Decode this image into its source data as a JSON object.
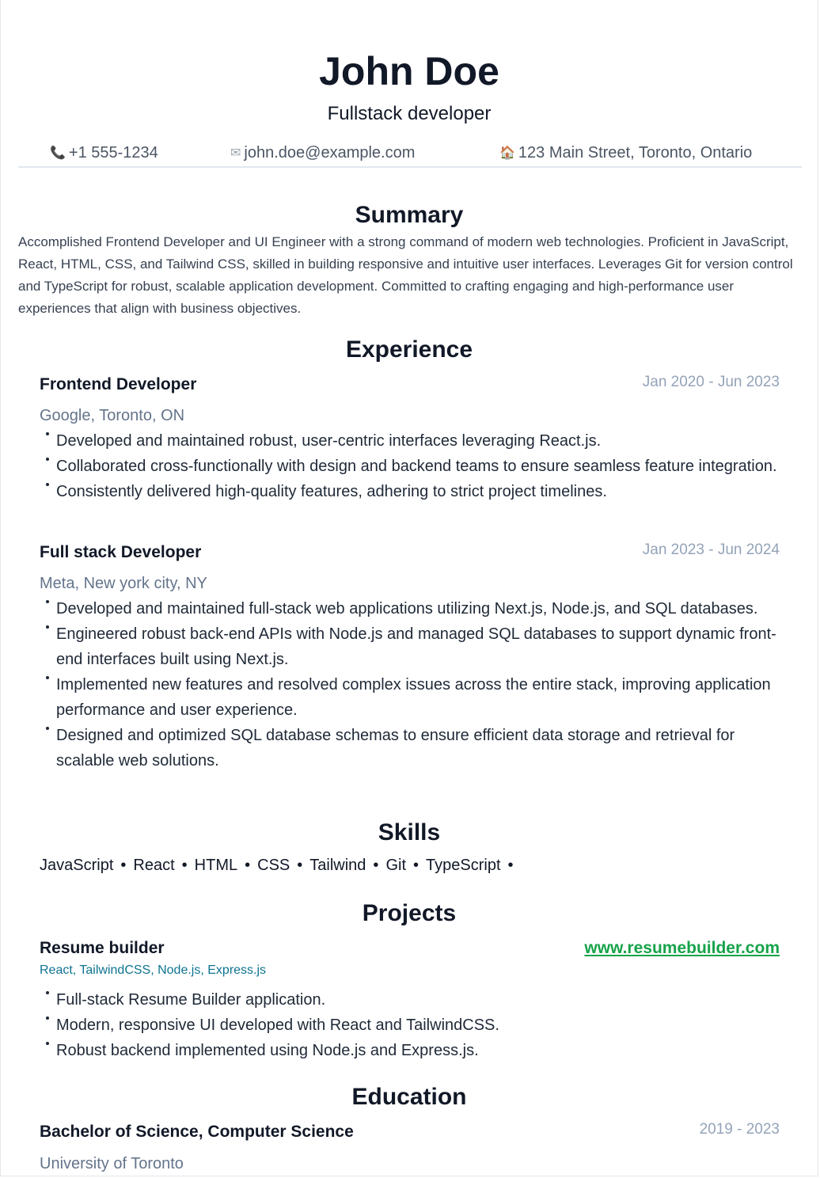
{
  "header": {
    "name": "John Doe",
    "role": "Fullstack developer",
    "phone": "+1 555-1234",
    "email": "john.doe@example.com",
    "address": "123 Main Street, Toronto, Ontario",
    "phone_icon": "📞",
    "email_icon": "✉",
    "address_icon": "🏠"
  },
  "summary": {
    "title": "Summary",
    "text": "Accomplished Frontend Developer and UI Engineer with a strong command of modern web technologies. Proficient in JavaScript, React, HTML, CSS, and Tailwind CSS, skilled in building responsive and intuitive user interfaces. Leverages Git for version control and TypeScript for robust, scalable application development. Committed to crafting engaging and high-performance user experiences that align with business objectives."
  },
  "experience": {
    "title": "Experience",
    "jobs": [
      {
        "title": "Frontend Developer",
        "dates": "Jan 2020 - Jun 2023",
        "org": "Google, Toronto, ON",
        "bullets": [
          "Developed and maintained robust, user-centric interfaces leveraging React.js.",
          "Collaborated cross-functionally with design and backend teams to ensure seamless feature integration.",
          "Consistently delivered high-quality features, adhering to strict project timelines."
        ]
      },
      {
        "title": "Full stack Developer",
        "dates": "Jan 2023 - Jun 2024",
        "org": "Meta, New york city, NY",
        "bullets": [
          "Developed and maintained full-stack web applications utilizing Next.js, Node.js, and SQL databases.",
          "Engineered robust back-end APIs with Node.js and managed SQL databases to support dynamic front-end interfaces built using Next.js.",
          "Implemented new features and resolved complex issues across the entire stack, improving application performance and user experience.",
          "Designed and optimized SQL database schemas to ensure efficient data storage and retrieval for scalable web solutions."
        ]
      }
    ]
  },
  "skills": {
    "title": "Skills",
    "separator": "•",
    "items": [
      "JavaScript",
      "React",
      "HTML",
      "CSS",
      "Tailwind",
      "Git",
      "TypeScript"
    ]
  },
  "projects": {
    "title": "Projects",
    "items": [
      {
        "title": "Resume builder",
        "link": "www.resumebuilder.com",
        "tech": "React, TailwindCSS, Node.js, Express.js",
        "bullets": [
          "Full-stack Resume Builder application.",
          "Modern, responsive UI developed with React and TailwindCSS.",
          "Robust backend implemented using Node.js and Express.js."
        ]
      }
    ]
  },
  "education": {
    "title": "Education",
    "items": [
      {
        "degree": "Bachelor of Science, Computer Science",
        "dates": "2019 - 2023",
        "school": "University of Toronto"
      }
    ]
  }
}
